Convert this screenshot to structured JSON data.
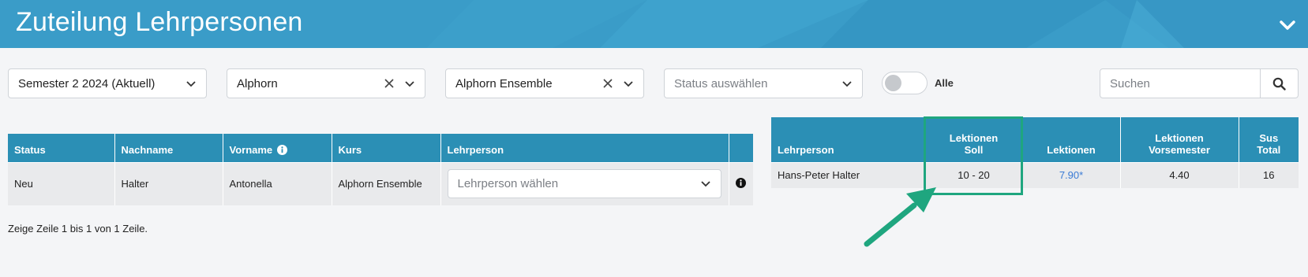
{
  "header": {
    "title": "Zuteilung Lehrpersonen",
    "collapse_icon": "chevron-down-icon"
  },
  "filters": {
    "semester": {
      "value": "Semester 2 2024 (Aktuell)"
    },
    "instrument": {
      "value": "Alphorn"
    },
    "course": {
      "value": "Alphorn Ensemble"
    },
    "status": {
      "placeholder": "Status auswählen"
    },
    "toggle": {
      "label": "Alle",
      "checked": false
    },
    "search": {
      "placeholder": "Suchen"
    }
  },
  "students_table": {
    "headers": [
      "Status",
      "Nachname",
      "Vorname",
      "Kurs",
      "Lehrperson",
      ""
    ],
    "rows": [
      {
        "status": "Neu",
        "nachname": "Halter",
        "vorname": "Antonella",
        "kurs": "Alphorn Ensemble",
        "lehrperson_placeholder": "Lehrperson wählen"
      }
    ],
    "footer": "Zeige Zeile 1 bis 1 von 1 Zeile."
  },
  "teachers_table": {
    "headers": {
      "lehrperson": "Lehrperson",
      "soll_line1": "Lektionen",
      "soll_line2": "Soll",
      "lektionen": "Lektionen",
      "vorsemester_line1": "Lektionen",
      "vorsemester_line2": "Vorsemester",
      "sus_line1": "Sus",
      "sus_line2": "Total"
    },
    "rows": [
      {
        "lehrperson": "Hans-Peter Halter",
        "soll": "10 - 20",
        "lektionen": "7.90*",
        "vorsemester": "4.40",
        "sus_total": "16"
      }
    ]
  },
  "colors": {
    "header_bg": "#3a9cc8",
    "table_header": "#2b8fb5",
    "highlight": "#1fa67f",
    "link": "#3a7bd5"
  }
}
